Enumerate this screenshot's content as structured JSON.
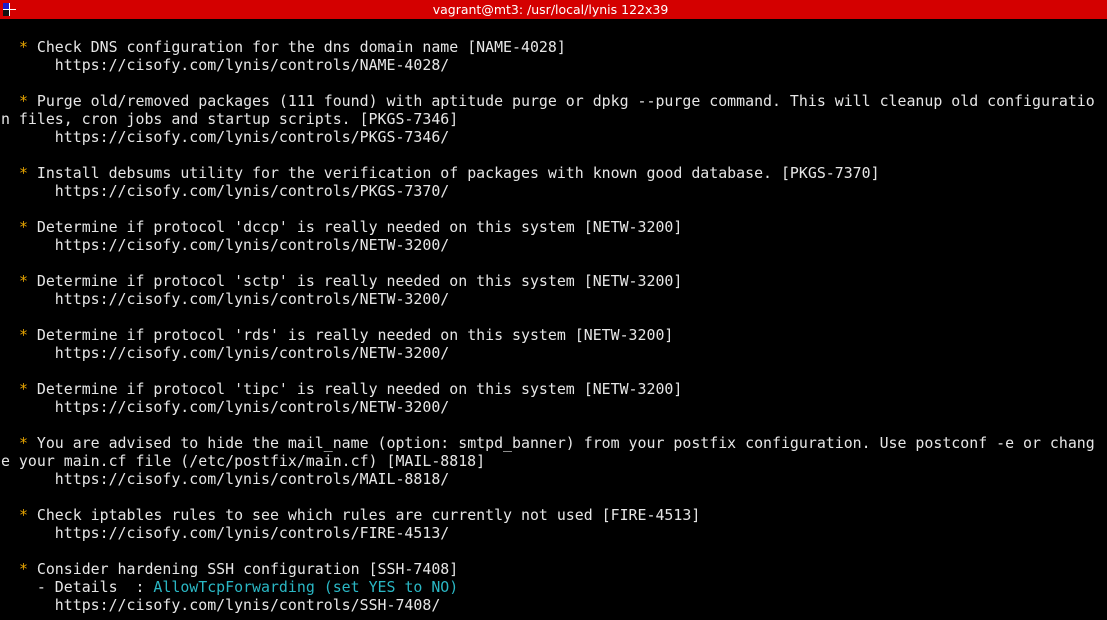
{
  "window": {
    "title": "vagrant@mt3: /usr/local/lynis 122x39"
  },
  "terminal": {
    "suggestions": [
      {
        "lines": [
          "Check DNS configuration for the dns domain name [NAME-4028]"
        ],
        "url": "https://cisofy.com/lynis/controls/NAME-4028/"
      },
      {
        "lines": [
          "Purge old/removed packages (111 found) with aptitude purge or dpkg --purge command. This will cleanup old configuratio",
          "n files, cron jobs and startup scripts. [PKGS-7346]"
        ],
        "url": "https://cisofy.com/lynis/controls/PKGS-7346/"
      },
      {
        "lines": [
          "Install debsums utility for the verification of packages with known good database. [PKGS-7370]"
        ],
        "url": "https://cisofy.com/lynis/controls/PKGS-7370/"
      },
      {
        "lines": [
          "Determine if protocol 'dccp' is really needed on this system [NETW-3200]"
        ],
        "url": "https://cisofy.com/lynis/controls/NETW-3200/"
      },
      {
        "lines": [
          "Determine if protocol 'sctp' is really needed on this system [NETW-3200]"
        ],
        "url": "https://cisofy.com/lynis/controls/NETW-3200/"
      },
      {
        "lines": [
          "Determine if protocol 'rds' is really needed on this system [NETW-3200]"
        ],
        "url": "https://cisofy.com/lynis/controls/NETW-3200/"
      },
      {
        "lines": [
          "Determine if protocol 'tipc' is really needed on this system [NETW-3200]"
        ],
        "url": "https://cisofy.com/lynis/controls/NETW-3200/"
      },
      {
        "lines": [
          "You are advised to hide the mail_name (option: smtpd_banner) from your postfix configuration. Use postconf -e or chang",
          "e your main.cf file (/etc/postfix/main.cf) [MAIL-8818]"
        ],
        "url": "https://cisofy.com/lynis/controls/MAIL-8818/"
      },
      {
        "lines": [
          "Check iptables rules to see which rules are currently not used [FIRE-4513]"
        ],
        "url": "https://cisofy.com/lynis/controls/FIRE-4513/"
      },
      {
        "lines": [
          "Consider hardening SSH configuration [SSH-7408]"
        ],
        "details_label": "- Details  : ",
        "details_value": "AllowTcpForwarding (set YES to NO)",
        "url": "https://cisofy.com/lynis/controls/SSH-7408/"
      }
    ]
  },
  "colors": {
    "titlebar_bg": "#d40000",
    "terminal_bg": "#000000",
    "text": "#e6e6e6",
    "bullet": "#e8a600",
    "highlight": "#2ab7c4"
  }
}
